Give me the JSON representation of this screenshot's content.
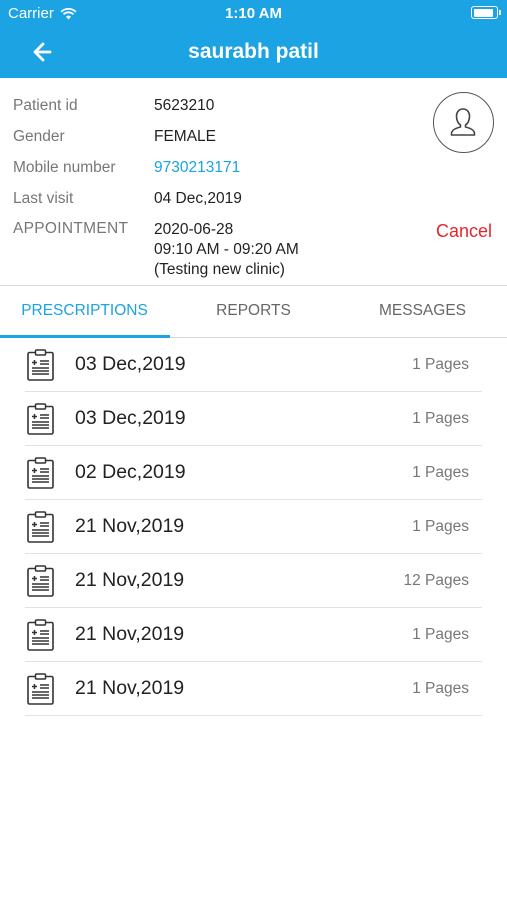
{
  "status_bar": {
    "carrier": "Carrier",
    "time": "1:10 AM",
    "battery_level": 0.9
  },
  "header": {
    "title": "saurabh patil",
    "back_icon": "arrow-left-icon"
  },
  "patient": {
    "patient_id_label": "Patient id",
    "patient_id": "5623210",
    "gender_label": "Gender",
    "gender": "FEMALE",
    "mobile_label": "Mobile number",
    "mobile": "9730213171",
    "last_visit_label": "Last visit",
    "last_visit": "04 Dec,2019",
    "appointment_label": "APPOINTMENT",
    "appointment_date": "2020-06-28",
    "appointment_time": "09:10 AM - 09:20 AM",
    "appointment_clinic": "(Testing new clinic)",
    "cancel_label": "Cancel"
  },
  "tabs": [
    {
      "label": "PRESCRIPTIONS",
      "active": true
    },
    {
      "label": "REPORTS",
      "active": false
    },
    {
      "label": "MESSAGES",
      "active": false
    }
  ],
  "prescriptions": [
    {
      "date": "03 Dec,2019",
      "pages": "1 Pages"
    },
    {
      "date": "03 Dec,2019",
      "pages": "1 Pages"
    },
    {
      "date": "02 Dec,2019",
      "pages": "1 Pages"
    },
    {
      "date": "21 Nov,2019",
      "pages": "1 Pages"
    },
    {
      "date": "21 Nov,2019",
      "pages": "12 Pages"
    },
    {
      "date": "21 Nov,2019",
      "pages": "1 Pages"
    },
    {
      "date": "21 Nov,2019",
      "pages": "1 Pages"
    }
  ],
  "colors": {
    "accent": "#1ba3e3",
    "cancel": "#e5262a",
    "label": "#777777"
  }
}
